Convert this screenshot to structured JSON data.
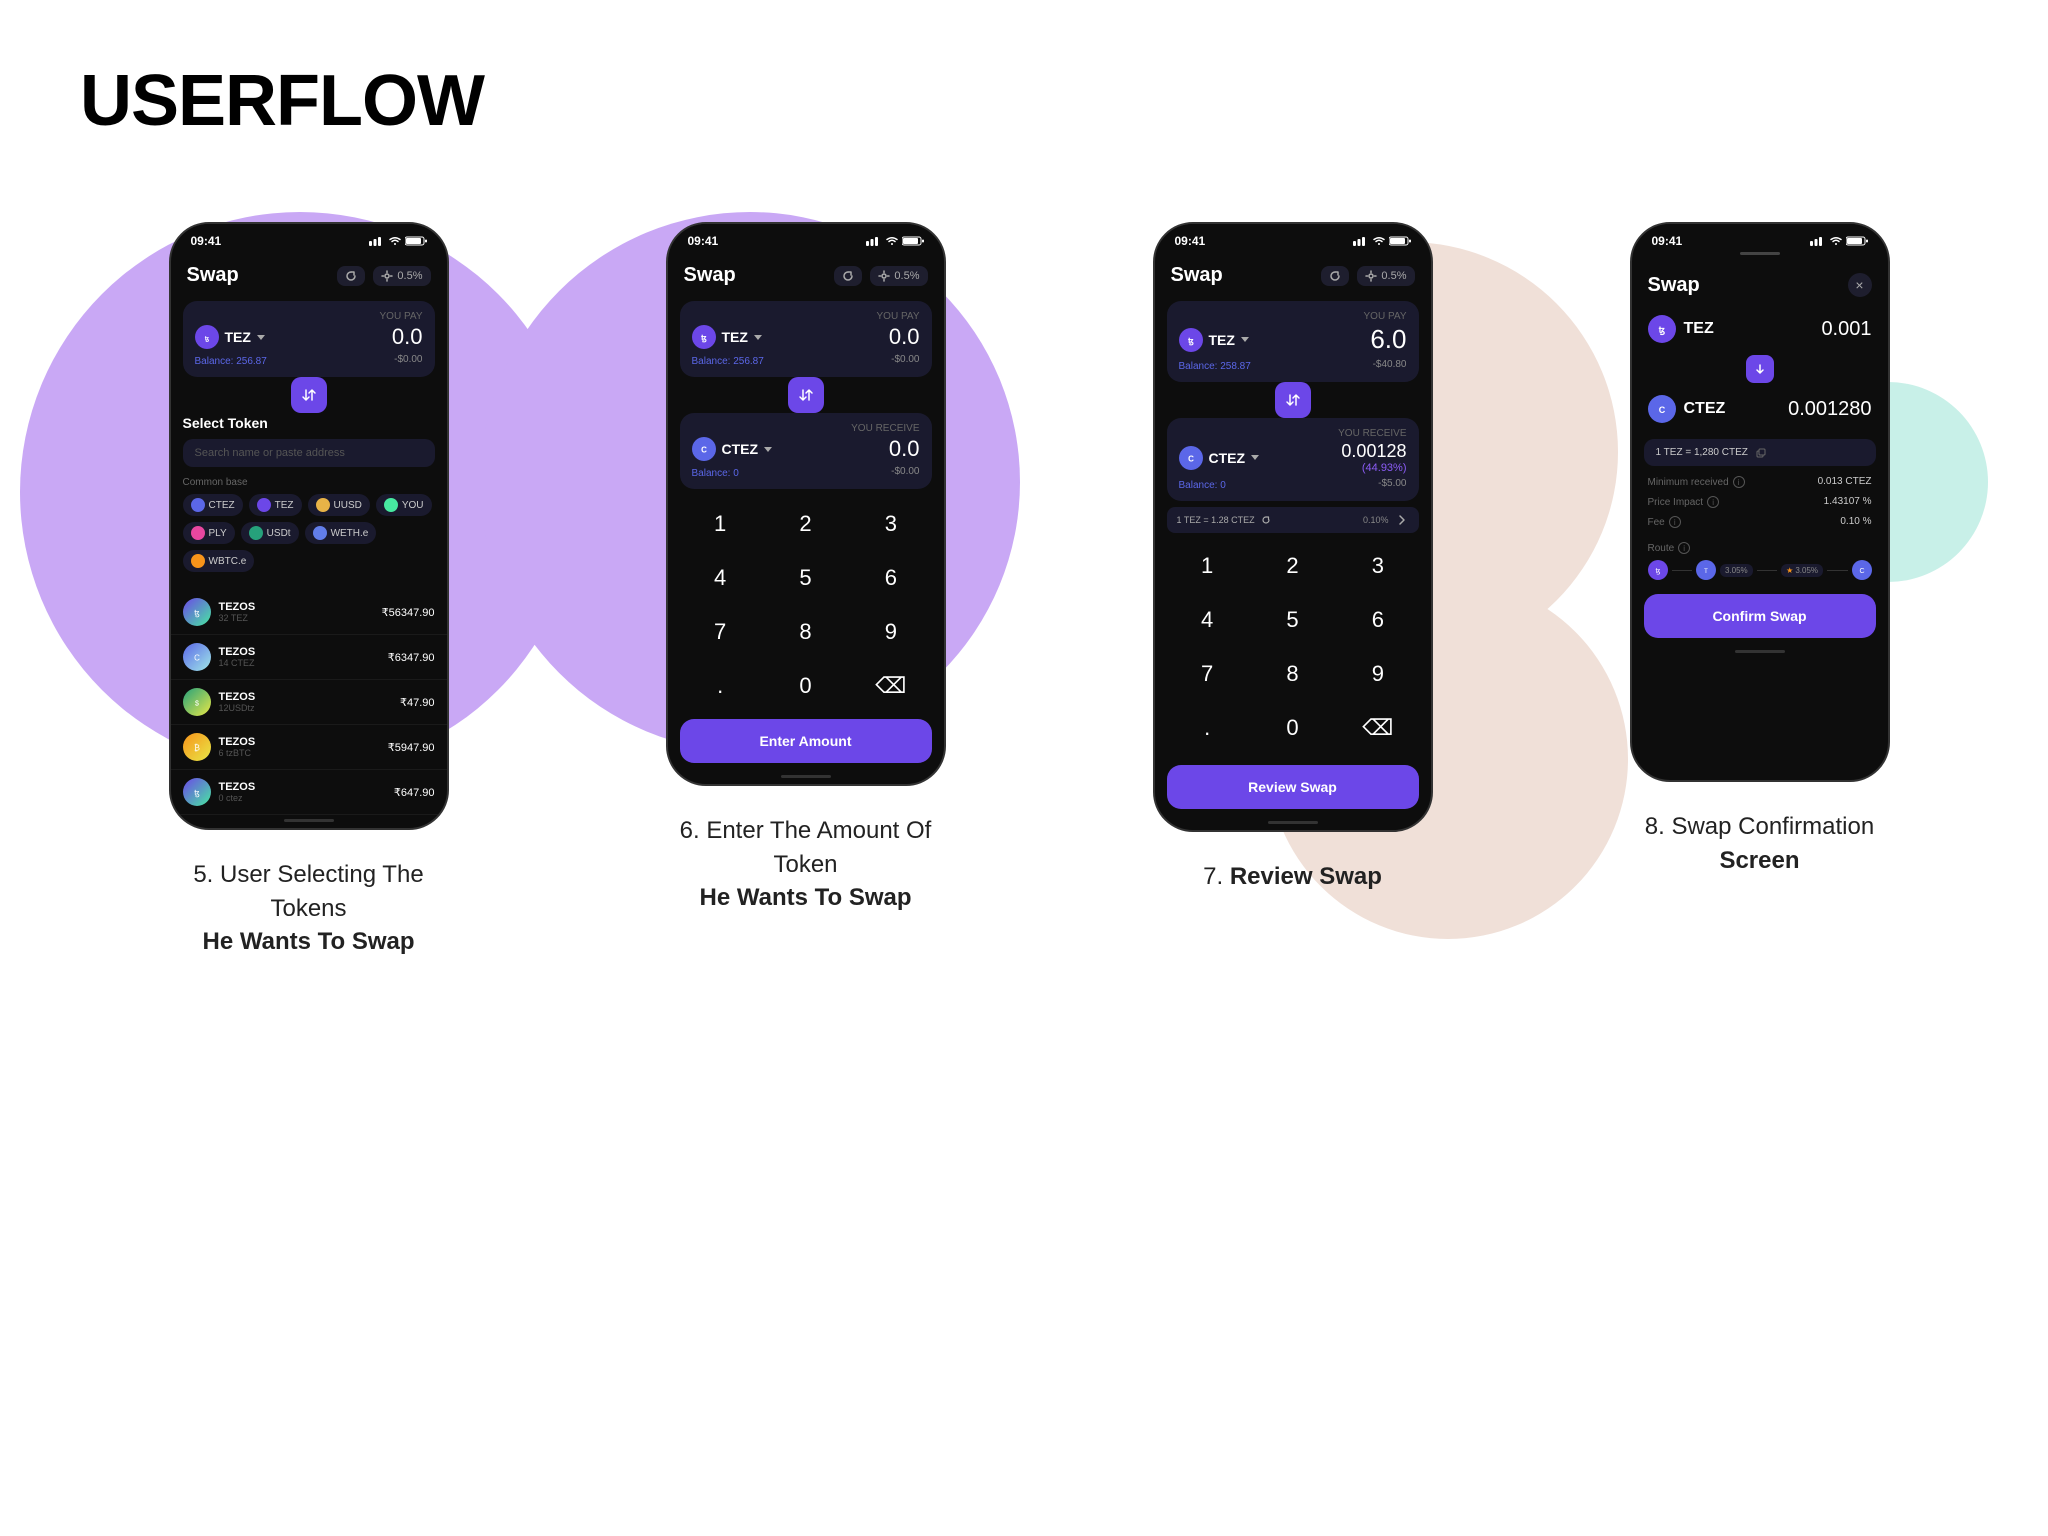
{
  "page": {
    "title": "USERFLOW"
  },
  "screens": [
    {
      "id": "screen5",
      "step": "5.",
      "caption_line1": "User Selecting The Tokens",
      "caption_line2": "He Wants To Swap",
      "status_time": "09:41",
      "swap_title": "Swap",
      "settings_label": "0.5%",
      "token_from": {
        "name": "TEZ",
        "color": "#6c47e8",
        "label": "YOU PAY",
        "amount": "0.0",
        "balance": "Balance: 256.87",
        "usd": "-$0.00"
      },
      "select_token_title": "Select Token",
      "search_placeholder": "Search name or paste address",
      "common_base_label": "Common base",
      "chips": [
        "CTEZ",
        "TEZ",
        "UUSD",
        "YOU",
        "PLY",
        "USDt",
        "WETH.e",
        "WBTC.e"
      ],
      "token_list": [
        {
          "name": "TEZOS",
          "sub": "32 TEZ",
          "amount": "₹56347.90"
        },
        {
          "name": "TEZOS",
          "sub": "14 CTEZ",
          "amount": "₹6347.90"
        },
        {
          "name": "TEZOS",
          "sub": "12USDtz",
          "amount": "₹47.90"
        },
        {
          "name": "TEZOS",
          "sub": "6 tzBTC",
          "amount": "₹5947.90"
        },
        {
          "name": "TEZOS",
          "sub": "0 ctez",
          "amount": "₹647.90"
        }
      ]
    },
    {
      "id": "screen6",
      "step": "6.",
      "caption_line1": "Enter The Amount Of Token",
      "caption_line2": "He Wants To Swap",
      "status_time": "09:41",
      "swap_title": "Swap",
      "settings_label": "0.5%",
      "token_from": {
        "name": "TEZ",
        "color": "#6c47e8",
        "label": "YOU PAY",
        "amount": "0.0",
        "balance": "Balance: 256.87",
        "usd": "-$0.00"
      },
      "token_to": {
        "name": "CTEZ",
        "color": "#5b67e8",
        "label": "YOU RECEIVE",
        "amount": "0.0",
        "balance": "Balance: 0",
        "usd": "-$0.00"
      },
      "numpad_keys": [
        "1",
        "2",
        "3",
        "4",
        "5",
        "6",
        "7",
        "8",
        "9",
        ".",
        "0",
        "⌫"
      ],
      "enter_amount_label": "Enter Amount"
    },
    {
      "id": "screen7",
      "step": "7.",
      "caption_line1": "Review Swap",
      "caption_line2": "",
      "status_time": "09:41",
      "swap_title": "Swap",
      "settings_label": "0.5%",
      "token_from": {
        "name": "TEZ",
        "color": "#6c47e8",
        "label": "YOU PAY",
        "amount": "6.0",
        "balance": "Balance: 258.87",
        "usd": "-$40.80"
      },
      "token_to": {
        "name": "CTEZ",
        "color": "#5b67e8",
        "label": "YOU RECEIVE",
        "amount": "0.00128",
        "amount_prefix": "0.00128",
        "pct": "(44.93%)",
        "balance": "Balance: 0",
        "usd": "-$5.00"
      },
      "price_info": "1 TEZ = 1.28 CTEZ",
      "impact_pct": "0.10%",
      "numpad_keys": [
        "1",
        "2",
        "3",
        "4",
        "5",
        "6",
        "7",
        "8",
        "9",
        ".",
        "0",
        "⌫"
      ],
      "review_swap_label": "Review Swap"
    },
    {
      "id": "screen8",
      "step": "8.",
      "caption_line1": "Swap Confirmation",
      "caption_line2": "Screen",
      "status_time": "09:41",
      "swap_title": "Swap",
      "close_label": "×",
      "token_from": {
        "name": "TEZ",
        "color": "#6c47e8",
        "amount": "0.001"
      },
      "token_to": {
        "name": "CTEZ",
        "color": "#5b67e8",
        "amount": "0.001280"
      },
      "rate_label": "1 TEZ = 1,280 CTEZ",
      "details": [
        {
          "label": "Minimum received",
          "value": "0.013 CTEZ"
        },
        {
          "label": "Price Impact",
          "value": "1.43107 %"
        },
        {
          "label": "Fee",
          "value": "0.10 %"
        }
      ],
      "route_label": "Route",
      "route_nodes": [
        "TEZ",
        "3.05%",
        "★ 3.05%",
        "CTEZ"
      ],
      "confirm_swap_label": "Confirm Swap"
    }
  ]
}
